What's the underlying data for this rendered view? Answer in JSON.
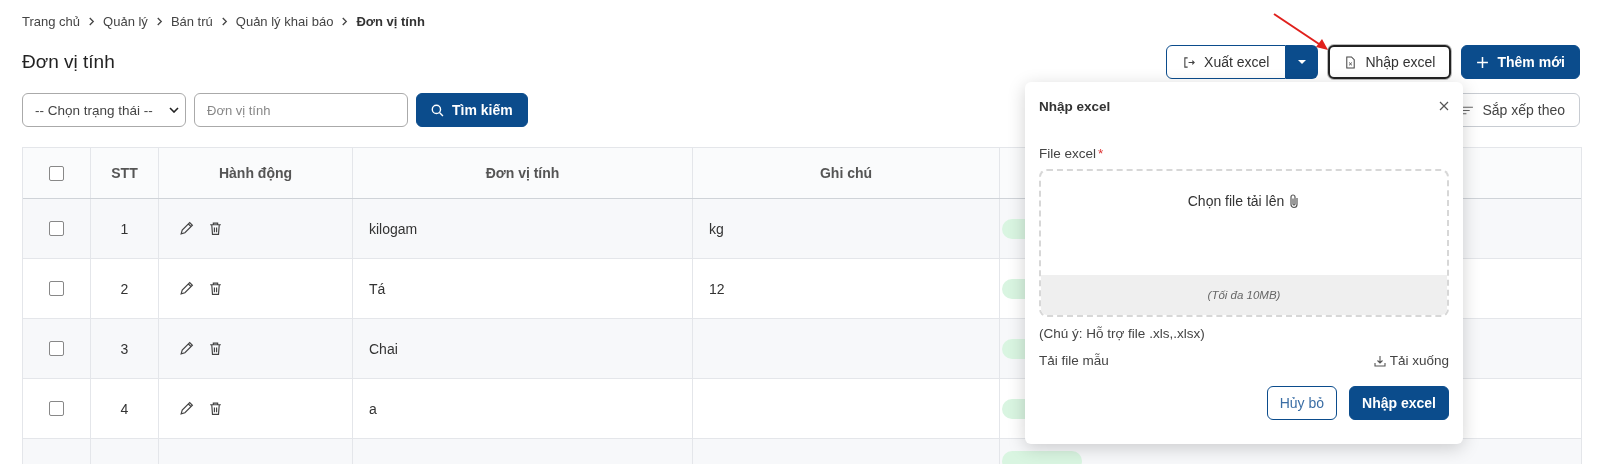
{
  "breadcrumb": [
    {
      "label": "Trang chủ",
      "current": false
    },
    {
      "label": "Quản lý",
      "current": false
    },
    {
      "label": "Bán trú",
      "current": false
    },
    {
      "label": "Quản lý khai báo",
      "current": false
    },
    {
      "label": "Đơn vị tính",
      "current": true
    }
  ],
  "page_title": "Đơn vị tính",
  "header_actions": {
    "export": "Xuất excel",
    "import": "Nhập excel",
    "add": "Thêm mới"
  },
  "filters": {
    "status_select": "-- Chọn trạng thái --",
    "name_placeholder": "Đơn vị tính",
    "search_button": "Tìm kiếm",
    "sort_button": "Sắp xếp theo"
  },
  "table": {
    "columns": [
      "STT",
      "Hành động",
      "Đơn vị tính",
      "Ghi chú"
    ],
    "rows": [
      {
        "stt": "1",
        "name": "kilogam",
        "note": "kg",
        "checked": false
      },
      {
        "stt": "2",
        "name": "Tá",
        "note": "12",
        "checked": false
      },
      {
        "stt": "3",
        "name": "Chai",
        "note": "",
        "checked": false
      },
      {
        "stt": "4",
        "name": "a",
        "note": "",
        "checked": false
      }
    ],
    "select_all_checked": false
  },
  "import_dialog": {
    "title": "Nhập excel",
    "field_label": "File excel",
    "required_mark": "*",
    "drop_text": "Chọn file tải lên",
    "max_size": "(Tối đa 10MB)",
    "note": "(Chú ý: Hỗ trợ file .xls,.xlsx)",
    "template_label": "Tải file mẫu",
    "download_link": "Tải xuống",
    "cancel_button": "Hủy bỏ",
    "submit_button": "Nhập excel"
  }
}
